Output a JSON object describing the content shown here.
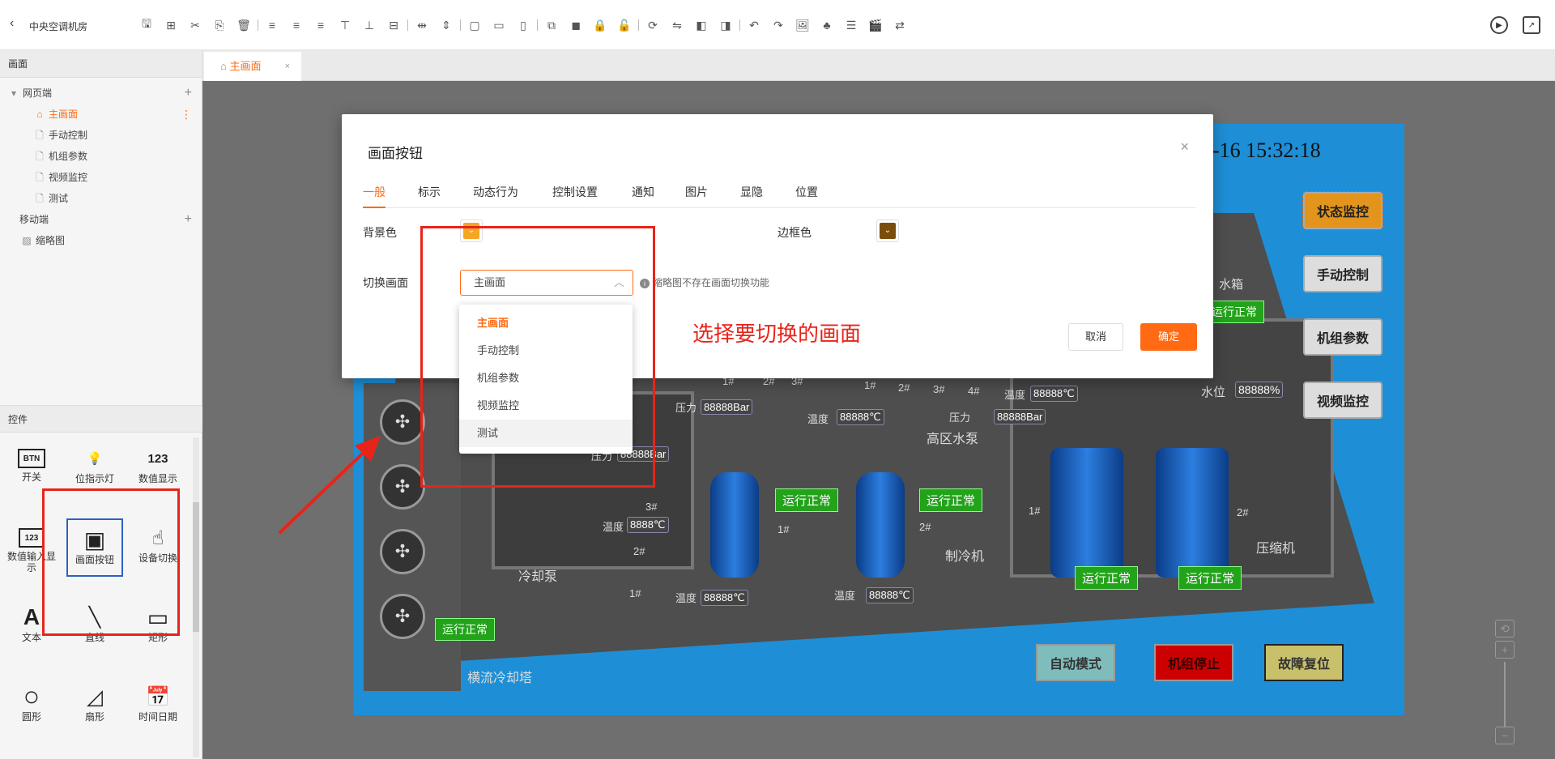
{
  "app": {
    "title": "中央空调机房"
  },
  "left_panel": {
    "section_title": "画面",
    "groups": [
      {
        "label": "网页端"
      },
      {
        "label": "移动端"
      }
    ],
    "pages": [
      "主画面",
      "手动控制",
      "机组参数",
      "视频监控",
      "测试"
    ],
    "mobile_pages": [
      "缩略图"
    ]
  },
  "controls": {
    "section_title": "控件",
    "items": [
      {
        "glyph": "BTN",
        "label": "开关"
      },
      {
        "glyph": "💡",
        "label": "位指示灯"
      },
      {
        "glyph": "123",
        "label": "数值显示"
      },
      {
        "glyph": "123",
        "label": "数值输入显示"
      },
      {
        "glyph": "▣",
        "label": "画面按钮"
      },
      {
        "glyph": "☝",
        "label": "设备切换"
      },
      {
        "glyph": "A",
        "label": "文本"
      },
      {
        "glyph": "╲",
        "label": "直线"
      },
      {
        "glyph": "▭",
        "label": "矩形"
      },
      {
        "glyph": "○",
        "label": "圆形"
      },
      {
        "glyph": "◿",
        "label": "扇形"
      },
      {
        "glyph": "📅",
        "label": "时间日期"
      }
    ]
  },
  "editor_tab": {
    "label": "主画面",
    "close": "×"
  },
  "scene": {
    "clock": "-16 15:32:18",
    "side_buttons": [
      "状态监控",
      "手动控制",
      "机组参数",
      "视频监控"
    ],
    "bottom_buttons": [
      {
        "label": "自动模式",
        "color": "#7fbcbc"
      },
      {
        "label": "机组停止",
        "color": "#cc0000"
      },
      {
        "label": "故障复位",
        "color": "#c8c06a"
      }
    ],
    "status": "运行正常",
    "labels": {
      "cooling_tower": "横流冷却塔",
      "cooling_pump": "冷却泵",
      "chiller": "制冷机",
      "high_pump": "高区水泵",
      "compressor": "压缩机",
      "water_level": "水位",
      "tank": "水箱",
      "pressure": "压力",
      "temperature": "温度"
    },
    "values": {
      "bar": "88888Bar",
      "temp": "88888℃",
      "temp2": "8888℃",
      "percent": "88888%"
    },
    "unit_numbers": [
      "1#",
      "2#",
      "3#",
      "4#"
    ]
  },
  "dialog": {
    "title": "画面按钮",
    "close": "×",
    "tabs": [
      "一般",
      "标示",
      "动态行为",
      "控制设置",
      "通知",
      "图片",
      "显隐",
      "位置"
    ],
    "bg_color_label": "背景色",
    "border_color_label": "边框色",
    "bg_color": "#f5a623",
    "border_color": "#7a4e0a",
    "switch_label": "切换画面",
    "switch_value": "主画面",
    "hint": "缩略图不存在画面切换功能",
    "cancel": "取消",
    "ok": "确定"
  },
  "dropdown": {
    "options": [
      "主画面",
      "手动控制",
      "机组参数",
      "视频监控",
      "测试"
    ],
    "selected": "主画面"
  },
  "annotation": {
    "text": "选择要切换的画面",
    "color": "#e8241a"
  }
}
